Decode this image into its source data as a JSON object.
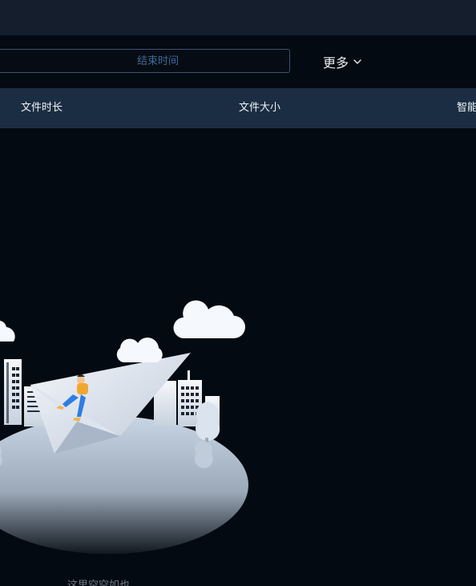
{
  "filters": {
    "end_time_placeholder": "结束时间",
    "more_label": "更多"
  },
  "table": {
    "columns": [
      "文件时长",
      "文件大小",
      "智能"
    ]
  },
  "empty_state": {
    "text": "这里空空如也"
  },
  "icons": {
    "more": "chevron-down-icon",
    "illustration": "empty-state-illustration"
  },
  "colors": {
    "page_background": "#040a12",
    "topbar_background": "#141e2d",
    "table_header_background": "#1b2d42",
    "input_border": "#3c5472",
    "placeholder": "#3c6a96"
  }
}
